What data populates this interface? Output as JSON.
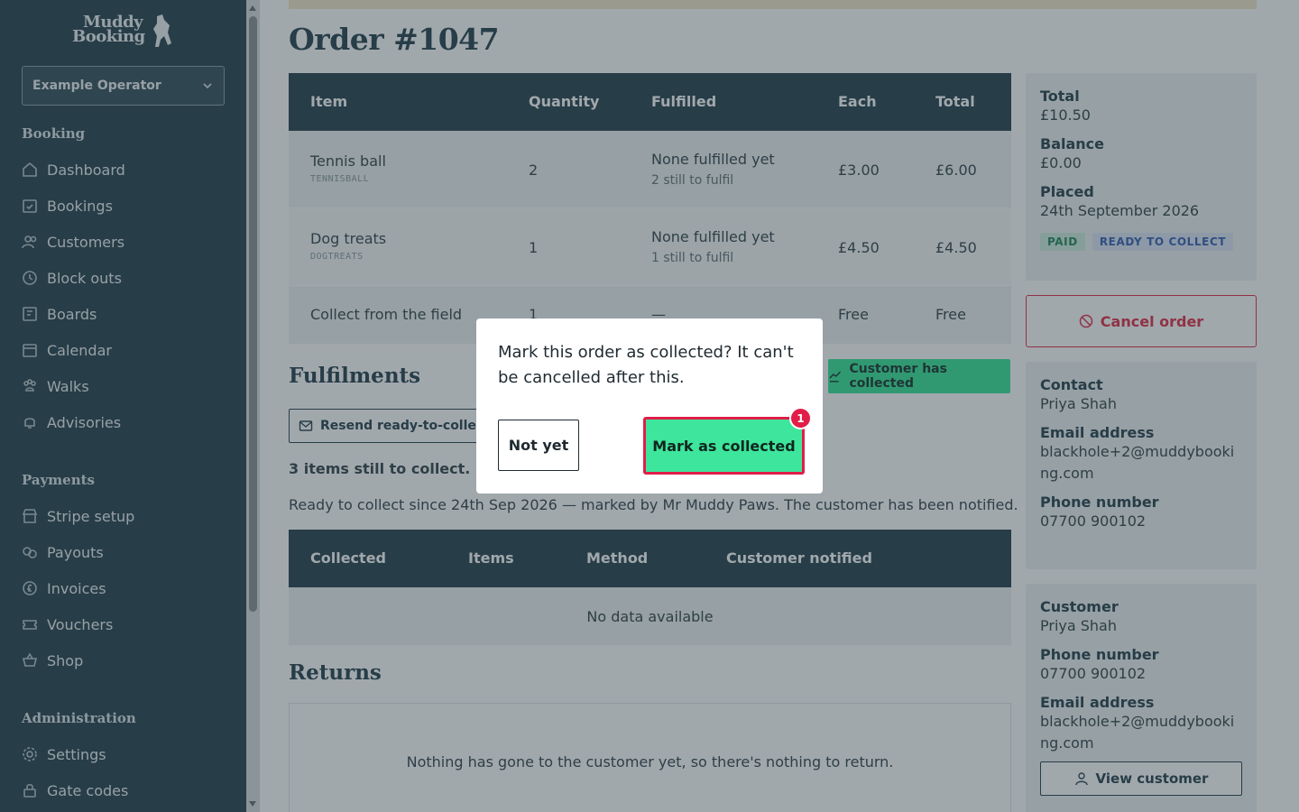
{
  "brand": {
    "logo_line1": "Muddy",
    "logo_line2": "Booking"
  },
  "operator": {
    "name": "Example Operator"
  },
  "sidebar": {
    "sections": [
      {
        "heading": "Booking",
        "items": [
          {
            "label": "Dashboard",
            "icon": "home-icon"
          },
          {
            "label": "Bookings",
            "icon": "calendar-check-icon"
          },
          {
            "label": "Customers",
            "icon": "users-icon"
          },
          {
            "label": "Block outs",
            "icon": "clock-icon"
          },
          {
            "label": "Boards",
            "icon": "board-icon"
          },
          {
            "label": "Calendar",
            "icon": "calendar-icon"
          },
          {
            "label": "Walks",
            "icon": "paw-icon"
          },
          {
            "label": "Advisories",
            "icon": "bell-icon"
          }
        ]
      },
      {
        "heading": "Payments",
        "items": [
          {
            "label": "Stripe setup",
            "icon": "store-icon"
          },
          {
            "label": "Payouts",
            "icon": "coins-icon"
          },
          {
            "label": "Invoices",
            "icon": "pound-icon"
          },
          {
            "label": "Vouchers",
            "icon": "ticket-icon"
          },
          {
            "label": "Shop",
            "icon": "basket-icon"
          }
        ]
      },
      {
        "heading": "Administration",
        "items": [
          {
            "label": "Settings",
            "icon": "gear-icon"
          },
          {
            "label": "Gate codes",
            "icon": "lock-icon"
          }
        ]
      }
    ]
  },
  "page": {
    "title": "Order #1047"
  },
  "items_table": {
    "headers": [
      "Item",
      "Quantity",
      "Fulfilled",
      "Each",
      "Total"
    ],
    "rows": [
      {
        "name": "Tennis ball",
        "code": "TENNISBALL",
        "quantity": "2",
        "fulfilled": "None fulfilled yet",
        "fulfilled_sub": "2 still to fulfil",
        "each": "£3.00",
        "total": "£6.00"
      },
      {
        "name": "Dog treats",
        "code": "DOGTREATS",
        "quantity": "1",
        "fulfilled": "None fulfilled yet",
        "fulfilled_sub": "1 still to fulfil",
        "each": "£4.50",
        "total": "£4.50"
      },
      {
        "name": "Collect from the field",
        "code": "",
        "quantity": "1",
        "fulfilled": "—",
        "fulfilled_sub": "",
        "each": "Free",
        "total": "Free"
      }
    ]
  },
  "fulfilments": {
    "heading": "Fulfilments",
    "customer_collected_label": "Customer has collected",
    "resend_label": "Resend ready-to-collect email",
    "items_remaining": "3 items still to collect.",
    "status_note": "Ready to collect since 24th Sep 2026 — marked by Mr Muddy Paws. The customer has been notified.",
    "table_headers": [
      "Collected",
      "Items",
      "Method",
      "Customer notified"
    ],
    "empty_text": "No data available"
  },
  "returns": {
    "heading": "Returns",
    "empty_text": "Nothing has gone to the customer yet, so there's nothing to return."
  },
  "summary": {
    "total_label": "Total",
    "total_value": "£10.50",
    "balance_label": "Balance",
    "balance_value": "£0.00",
    "placed_label": "Placed",
    "placed_value": "24th September 2026",
    "badges": [
      "PAID",
      "READY TO COLLECT"
    ]
  },
  "cancel_label": "Cancel order",
  "contact": {
    "heading": "Contact",
    "name": "Priya Shah",
    "email_label": "Email address",
    "email": "blackhole+2@muddybooking.com",
    "phone_label": "Phone number",
    "phone": "07700 900102"
  },
  "customer": {
    "heading": "Customer",
    "name": "Priya Shah",
    "phone_label": "Phone number",
    "phone": "07700 900102",
    "email_label": "Email address",
    "email": "blackhole+2@muddybooking.com",
    "view_label": "View customer"
  },
  "modal": {
    "message": "Mark this order as collected? It can't be cancelled after this.",
    "cancel_label": "Not yet",
    "confirm_label": "Mark as collected",
    "step_badge": "1"
  },
  "colors": {
    "sidebar": "#2d4853",
    "accent_green": "#3ee59c",
    "danger": "#e2344f"
  }
}
